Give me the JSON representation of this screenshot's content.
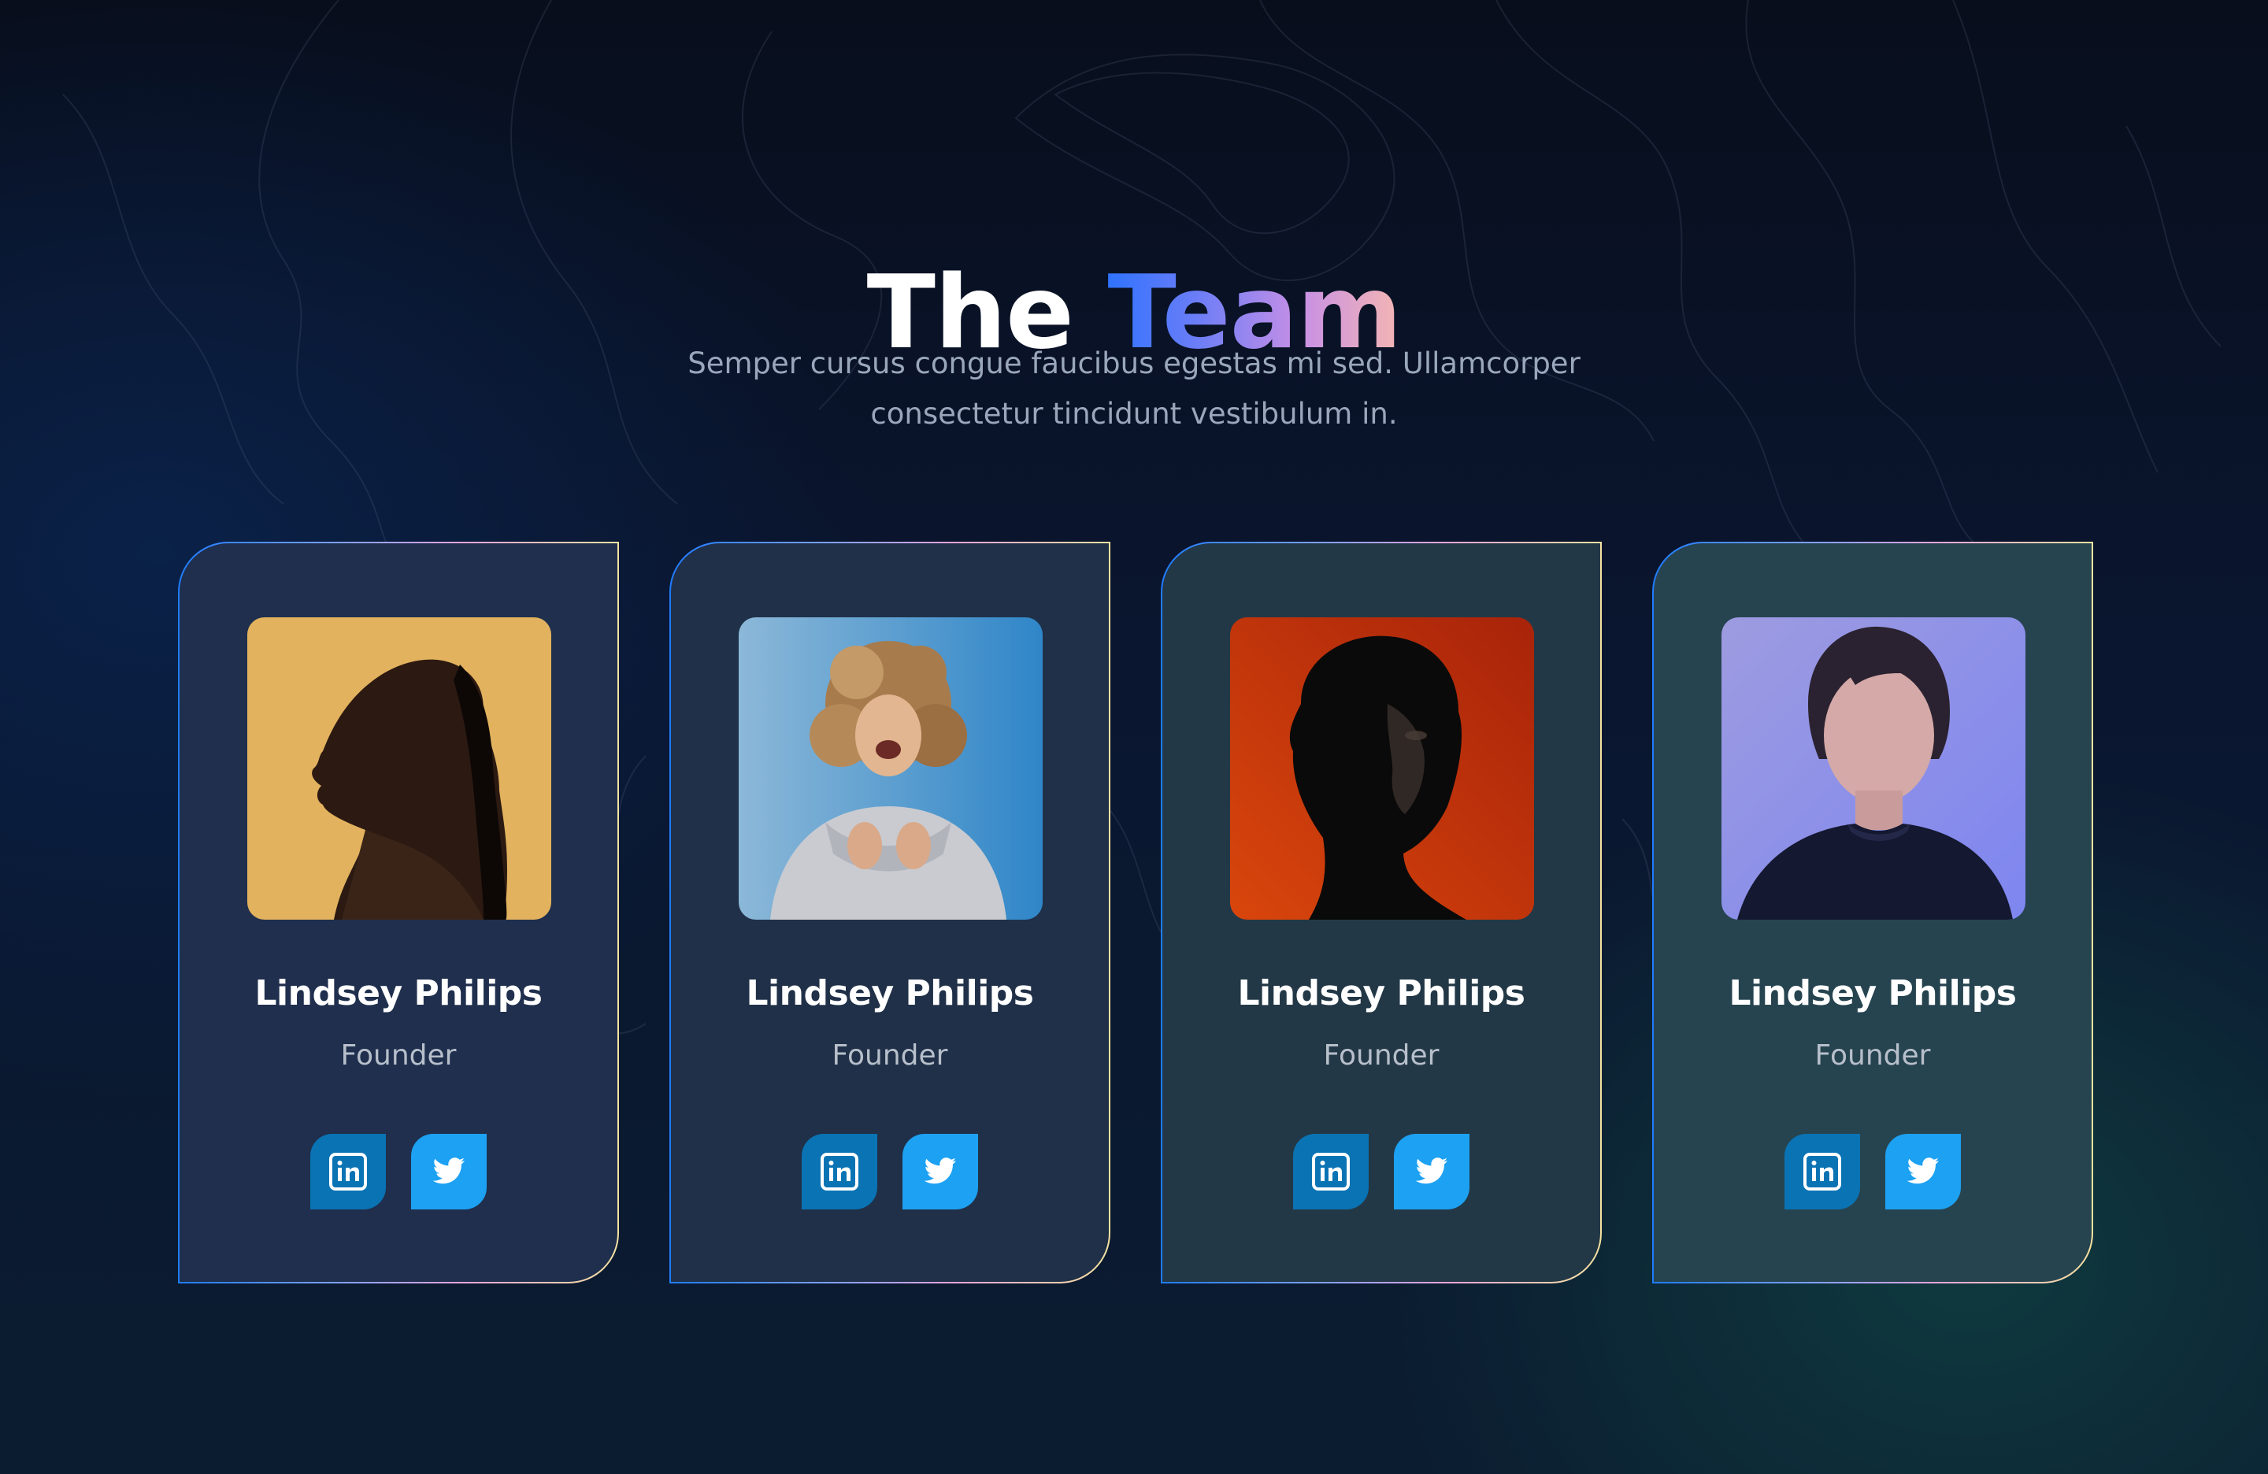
{
  "header": {
    "title_word1": "The",
    "title_word2": "Team",
    "subtitle": "Semper cursus congue faucibus egestas mi sed. Ullamcorper consectetur tincidunt vestibulum in."
  },
  "colors": {
    "title_gradient": [
      "#2f73ff",
      "#c68fe6",
      "#f4b6b2"
    ],
    "card_border_gradient": [
      "#1f7cff",
      "#e9a4d8",
      "#f6e3a1"
    ],
    "linkedin": "#0a73b4",
    "twitter": "#1da1f2"
  },
  "team": [
    {
      "name": "Lindsey Philips",
      "role": "Founder",
      "photo_bg": "#e2b25e",
      "icons": [
        "linkedin-icon",
        "twitter-icon"
      ]
    },
    {
      "name": "Lindsey Philips",
      "role": "Founder",
      "photo_bg": "#6fa8cf",
      "icons": [
        "linkedin-icon",
        "twitter-icon"
      ]
    },
    {
      "name": "Lindsey Philips",
      "role": "Founder",
      "photo_bg": "#c23a10",
      "icons": [
        "linkedin-icon",
        "twitter-icon"
      ]
    },
    {
      "name": "Lindsey Philips",
      "role": "Founder",
      "photo_bg": "#8e8fe2",
      "icons": [
        "linkedin-icon",
        "twitter-icon"
      ]
    }
  ]
}
